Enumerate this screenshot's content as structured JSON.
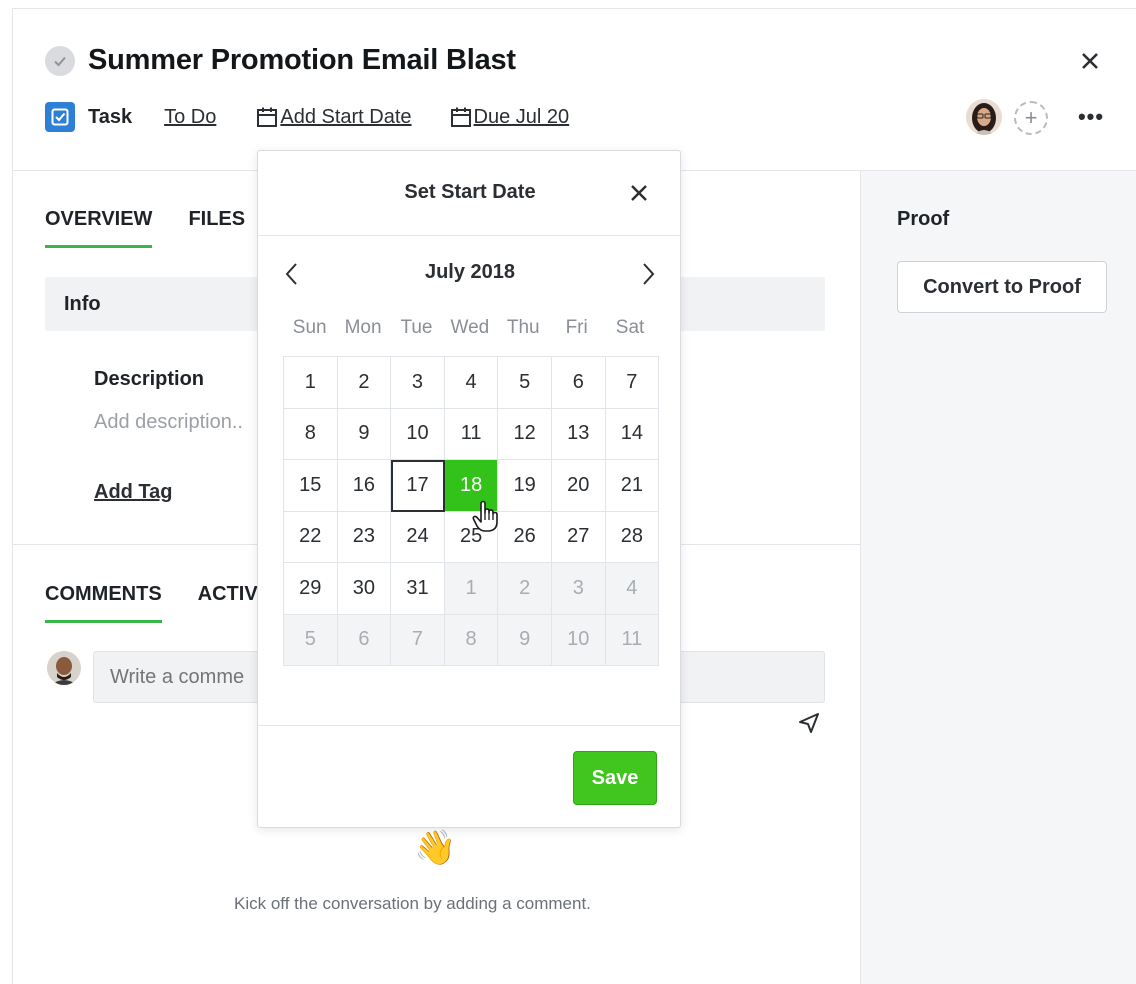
{
  "header": {
    "title": "Summer Promotion Email Blast",
    "type_label": "Task",
    "status": "To Do",
    "start_date": "Add Start Date",
    "due_date": "Due Jul 20",
    "more": "•••",
    "add_member": "+"
  },
  "tabs_top": [
    "OVERVIEW",
    "FILES"
  ],
  "info": {
    "heading": "Info",
    "description_label": "Description",
    "description_placeholder": "Add description..",
    "add_tag": "Add Tag"
  },
  "tabs_bottom": [
    "COMMENTS",
    "ACTIV"
  ],
  "comments": {
    "placeholder": "Write a comme",
    "empty_emoji": "👋",
    "empty_text": "Kick off the conversation by adding a comment."
  },
  "proof": {
    "heading": "Proof",
    "button": "Convert to Proof"
  },
  "datepicker": {
    "title": "Set Start Date",
    "month": "July 2018",
    "weekdays": [
      "Sun",
      "Mon",
      "Tue",
      "Wed",
      "Thu",
      "Fri",
      "Sat"
    ],
    "days": [
      {
        "d": "1",
        "other": false
      },
      {
        "d": "2",
        "other": false
      },
      {
        "d": "3",
        "other": false
      },
      {
        "d": "4",
        "other": false
      },
      {
        "d": "5",
        "other": false
      },
      {
        "d": "6",
        "other": false
      },
      {
        "d": "7",
        "other": false
      },
      {
        "d": "8",
        "other": false
      },
      {
        "d": "9",
        "other": false
      },
      {
        "d": "10",
        "other": false
      },
      {
        "d": "11",
        "other": false
      },
      {
        "d": "12",
        "other": false
      },
      {
        "d": "13",
        "other": false
      },
      {
        "d": "14",
        "other": false
      },
      {
        "d": "15",
        "other": false
      },
      {
        "d": "16",
        "other": false
      },
      {
        "d": "17",
        "other": false,
        "today": true
      },
      {
        "d": "18",
        "other": false,
        "selected": true
      },
      {
        "d": "19",
        "other": false
      },
      {
        "d": "20",
        "other": false
      },
      {
        "d": "21",
        "other": false
      },
      {
        "d": "22",
        "other": false
      },
      {
        "d": "23",
        "other": false
      },
      {
        "d": "24",
        "other": false
      },
      {
        "d": "25",
        "other": false
      },
      {
        "d": "26",
        "other": false
      },
      {
        "d": "27",
        "other": false
      },
      {
        "d": "28",
        "other": false
      },
      {
        "d": "29",
        "other": false
      },
      {
        "d": "30",
        "other": false
      },
      {
        "d": "31",
        "other": false
      },
      {
        "d": "1",
        "other": true
      },
      {
        "d": "2",
        "other": true
      },
      {
        "d": "3",
        "other": true
      },
      {
        "d": "4",
        "other": true
      },
      {
        "d": "5",
        "other": true
      },
      {
        "d": "6",
        "other": true
      },
      {
        "d": "7",
        "other": true
      },
      {
        "d": "8",
        "other": true
      },
      {
        "d": "9",
        "other": true
      },
      {
        "d": "10",
        "other": true
      },
      {
        "d": "11",
        "other": true
      }
    ],
    "save": "Save"
  },
  "colors": {
    "accent_green": "#41c51f",
    "selected_green": "#33c21a",
    "tab_underline": "#3bb54a",
    "task_blue": "#2e7fd6"
  },
  "icons": [
    "check-circle-icon",
    "close-icon",
    "task-checkbox-icon",
    "calendar-icon",
    "more-icon",
    "chevron-left-icon",
    "chevron-right-icon",
    "send-icon",
    "waving-hand-icon",
    "hand-pointer-icon"
  ]
}
